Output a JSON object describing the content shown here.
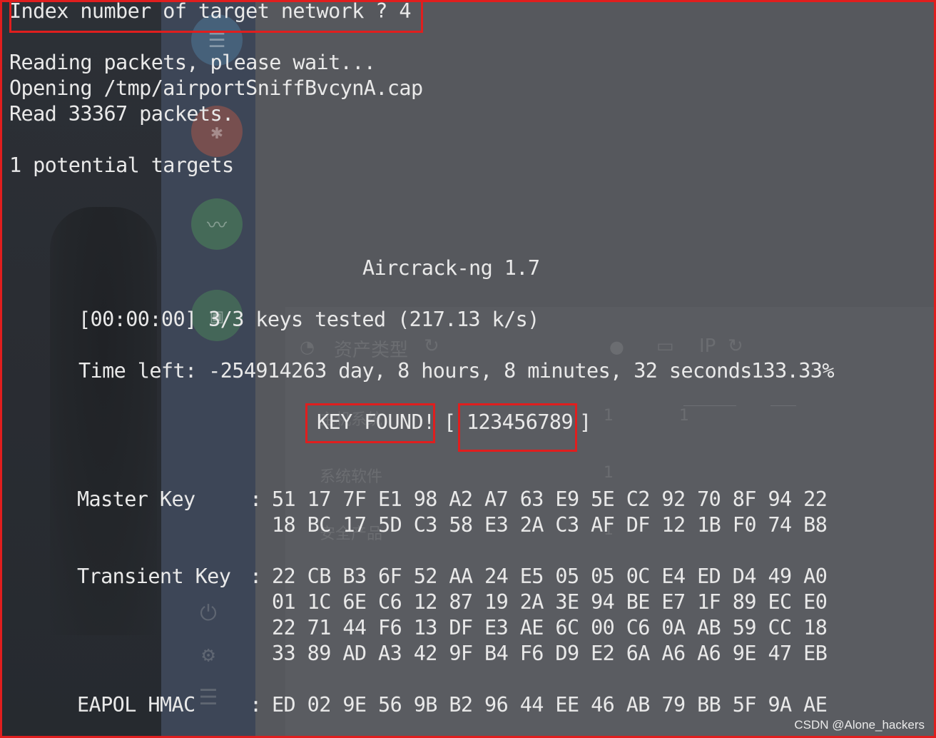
{
  "terminal": {
    "prompt_line": "Index number of target network ? 4",
    "reading": "Reading packets, please wait...",
    "opening": "Opening /tmp/airportSniffBvcynA.cap",
    "read_count": "Read 33367 packets.",
    "targets": "1 potential targets",
    "tool_version": "Aircrack-ng 1.7",
    "keys_tested": "[00:00:00] 3/3 keys tested (217.13 k/s)",
    "time_left": "Time left: -254914263 day, 8 hours, 8 minutes, 32 seconds",
    "progress": "133.33%",
    "key_found_label": "KEY FOUND!",
    "bracket_open": "[",
    "key_value": "123456789",
    "bracket_close": "]",
    "master_key_label": "Master Key",
    "master_key_lines": [
      "51 17 7F E1 98 A2 A7 63 E9 5E C2 92 70 8F 94 22",
      "18 BC 17 5D C3 58 E3 2A C3 AF DF 12 1B F0 74 B8"
    ],
    "transient_key_label": "Transient Key",
    "transient_key_lines": [
      "22 CB B3 6F 52 AA 24 E5 05 05 0C E4 ED D4 49 A0",
      "01 1C 6E C6 12 87 19 2A 3E 94 BE E7 1F 89 EC E0",
      "22 71 44 F6 13 DF E3 AE 6C 00 C6 0A AB 59 CC 18",
      "33 89 AD A3 42 9F B4 F6 D9 E2 6A A6 A6 9E 47 EB"
    ],
    "eapol_label": "EAPOL HMAC",
    "eapol_line": "ED 02 9E 56 9B B2 96 44 EE 46 AB 79 BB 5F 9A AE",
    "colon": ":"
  },
  "background": {
    "asset_type_label": "资产类型",
    "ip_label": "IP",
    "host_system_label": "主机系统",
    "host_system_count": "1",
    "system_software_label": "系统软件",
    "system_software_count": "1",
    "security_product_label": "安全产品",
    "security_product_count": "1",
    "extra_count": "1"
  },
  "watermark": "CSDN @Alone_hackers",
  "colors": {
    "highlight": "#e01e1e",
    "terminal_text": "#e9e9e9",
    "sidebar": "#3d4657"
  }
}
